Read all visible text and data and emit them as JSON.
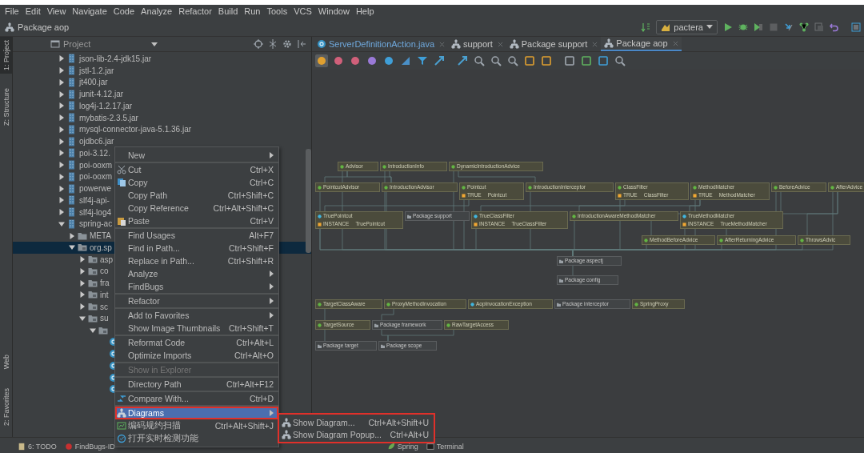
{
  "menu_bar": [
    "File",
    "Edit",
    "View",
    "Navigate",
    "Code",
    "Analyze",
    "Refactor",
    "Build",
    "Run",
    "Tools",
    "VCS",
    "Window",
    "Help"
  ],
  "navigation_bar": {
    "crumb": "Package aop",
    "run_config": "pactera"
  },
  "tool_strip": [
    {
      "label": "1: Project",
      "selected": true
    },
    {
      "label": "Z: Structure",
      "selected": false
    },
    {
      "label": "Web",
      "selected": false
    },
    {
      "label": "2: Favorites",
      "selected": false
    }
  ],
  "project_panel": {
    "title": "Project",
    "tree": [
      {
        "label": "json-lib-2.4-jdk15.jar",
        "kind": "jar",
        "expanded": false,
        "selected": false
      },
      {
        "label": "jstl-1.2.jar",
        "kind": "jar",
        "expanded": false,
        "selected": false
      },
      {
        "label": "jt400.jar",
        "kind": "jar",
        "expanded": false,
        "selected": false
      },
      {
        "label": "junit-4.12.jar",
        "kind": "jar",
        "expanded": false,
        "selected": false
      },
      {
        "label": "log4j-1.2.17.jar",
        "kind": "jar",
        "expanded": false,
        "selected": false
      },
      {
        "label": "mybatis-2.3.5.jar",
        "kind": "jar",
        "expanded": false,
        "selected": false
      },
      {
        "label": "mysql-connector-java-5.1.36.jar",
        "kind": "jar",
        "expanded": false,
        "selected": false
      },
      {
        "label": "ojdbc6.jar",
        "kind": "jar",
        "expanded": false,
        "selected": false
      },
      {
        "label": "poi-3.12.",
        "kind": "jar",
        "expanded": false,
        "selected": false
      },
      {
        "label": "poi-ooxm",
        "kind": "jar",
        "expanded": false,
        "selected": false
      },
      {
        "label": "poi-ooxm",
        "kind": "jar",
        "expanded": false,
        "selected": false
      },
      {
        "label": "powerwe",
        "kind": "jar",
        "expanded": false,
        "selected": false
      },
      {
        "label": "slf4j-api-",
        "kind": "jar",
        "expanded": false,
        "selected": false
      },
      {
        "label": "slf4j-log4",
        "kind": "jar",
        "expanded": false,
        "selected": false
      },
      {
        "label": "spring-ac",
        "kind": "jar",
        "expanded": true,
        "selected": false,
        "children": [
          {
            "label": "META",
            "kind": "folder",
            "expanded": false,
            "selected": false
          },
          {
            "label": "org.sp",
            "kind": "package",
            "expanded": true,
            "selected": true,
            "children": [
              {
                "label": "asp",
                "kind": "package",
                "expanded": false,
                "selected": false
              },
              {
                "label": "co",
                "kind": "package",
                "expanded": false,
                "selected": false
              },
              {
                "label": "fra",
                "kind": "package",
                "expanded": false,
                "selected": false
              },
              {
                "label": "int",
                "kind": "package",
                "expanded": false,
                "selected": false
              },
              {
                "label": "sc",
                "kind": "package",
                "expanded": false,
                "selected": false
              },
              {
                "label": "su",
                "kind": "package",
                "expanded": true,
                "selected": false,
                "children": [
                  {
                    "kind": "package",
                    "expanded": true,
                    "selected": false,
                    "children": [
                      {
                        "kind": "class",
                        "selected": false
                      },
                      {
                        "kind": "class",
                        "selected": false
                      },
                      {
                        "kind": "class",
                        "selected": false
                      },
                      {
                        "kind": "class",
                        "selected": false
                      },
                      {
                        "kind": "class",
                        "selected": false
                      }
                    ]
                  }
                ]
              }
            ]
          }
        ]
      }
    ]
  },
  "editor_tabs": [
    {
      "label": "ServerDefinitionAction.java",
      "kind": "class",
      "selected": false
    },
    {
      "label": "support",
      "kind": "diagram",
      "selected": false
    },
    {
      "label": "Package support",
      "kind": "diagram",
      "selected": false
    },
    {
      "label": "Package aop",
      "kind": "diagram",
      "selected": true
    }
  ],
  "diagram": {
    "nodes": [
      {
        "label": "Advisor",
        "kind": "interface"
      },
      {
        "label": "IntroductionInfo",
        "kind": "interface"
      },
      {
        "label": "DynamicIntroductionAdvice",
        "kind": "interface"
      },
      {
        "label": "PointcutAdvisor",
        "kind": "interface"
      },
      {
        "label": "IntroductionAdvisor",
        "kind": "interface"
      },
      {
        "label": "Pointcut",
        "kind": "interface",
        "fields": [
          {
            "name": "TRUE",
            "type": "Pointcut"
          }
        ]
      },
      {
        "label": "IntroductionInterceptor",
        "kind": "interface"
      },
      {
        "label": "ClassFilter",
        "kind": "interface",
        "fields": [
          {
            "name": "TRUE",
            "type": "ClassFilter"
          }
        ]
      },
      {
        "label": "MethodMatcher",
        "kind": "interface",
        "fields": [
          {
            "name": "TRUE",
            "type": "MethodMatcher"
          }
        ]
      },
      {
        "label": "BeforeAdvice",
        "kind": "interface"
      },
      {
        "label": "AfterAdvice",
        "kind": "interface"
      },
      {
        "label": "TruePointcut",
        "kind": "class",
        "fields": [
          {
            "name": "INSTANCE",
            "type": "TruePointcut"
          }
        ]
      },
      {
        "label": "Package support",
        "kind": "package"
      },
      {
        "label": "TrueClassFilter",
        "kind": "class",
        "fields": [
          {
            "name": "INSTANCE",
            "type": "TrueClassFilter"
          }
        ]
      },
      {
        "label": "IntroductionAwareMethodMatcher",
        "kind": "interface"
      },
      {
        "label": "TrueMethodMatcher",
        "kind": "class",
        "fields": [
          {
            "name": "INSTANCE",
            "type": "TrueMethodMatcher"
          }
        ]
      },
      {
        "label": "MethodBeforeAdvice",
        "kind": "interface"
      },
      {
        "label": "AfterReturningAdvice",
        "kind": "interface"
      },
      {
        "label": "ThrowsAdvic",
        "kind": "interface"
      },
      {
        "label": "Package aspectj",
        "kind": "package"
      },
      {
        "label": "Package config",
        "kind": "package"
      },
      {
        "label": "TargetClassAware",
        "kind": "interface"
      },
      {
        "label": "ProxyMethodInvocation",
        "kind": "interface"
      },
      {
        "label": "AopInvocationException",
        "kind": "class"
      },
      {
        "label": "Package interceptor",
        "kind": "package"
      },
      {
        "label": "SpringProxy",
        "kind": "interface"
      },
      {
        "label": "TargetSource",
        "kind": "interface"
      },
      {
        "label": "Package framework",
        "kind": "package"
      },
      {
        "label": "RawTargetAccess",
        "kind": "interface"
      },
      {
        "label": "Package target",
        "kind": "package"
      },
      {
        "label": "Package scope",
        "kind": "package"
      }
    ]
  },
  "context_menu": {
    "items": [
      {
        "label": "New",
        "submenu": true,
        "separator_before": false,
        "disabled": false,
        "selected": false,
        "highlighted": false
      },
      {
        "label": "Cut",
        "shortcut": "Ctrl+X",
        "submenu": false,
        "separator_before": true,
        "disabled": false,
        "selected": false,
        "highlighted": false
      },
      {
        "label": "Copy",
        "shortcut": "Ctrl+C",
        "submenu": false,
        "separator_before": false,
        "disabled": false,
        "selected": false,
        "highlighted": false
      },
      {
        "label": "Copy Path",
        "shortcut": "Ctrl+Shift+C",
        "submenu": false,
        "separator_before": false,
        "disabled": false,
        "selected": false,
        "highlighted": false
      },
      {
        "label": "Copy Reference",
        "shortcut": "Ctrl+Alt+Shift+C",
        "submenu": false,
        "separator_before": false,
        "disabled": false,
        "selected": false,
        "highlighted": false
      },
      {
        "label": "Paste",
        "shortcut": "Ctrl+V",
        "submenu": false,
        "separator_before": false,
        "disabled": false,
        "selected": false,
        "highlighted": false
      },
      {
        "label": "Find Usages",
        "shortcut": "Alt+F7",
        "submenu": false,
        "separator_before": true,
        "disabled": false,
        "selected": false,
        "highlighted": false
      },
      {
        "label": "Find in Path...",
        "shortcut": "Ctrl+Shift+F",
        "submenu": false,
        "separator_before": false,
        "disabled": false,
        "selected": false,
        "highlighted": false
      },
      {
        "label": "Replace in Path...",
        "shortcut": "Ctrl+Shift+R",
        "submenu": false,
        "separator_before": false,
        "disabled": false,
        "selected": false,
        "highlighted": false
      },
      {
        "label": "Analyze",
        "submenu": true,
        "separator_before": false,
        "disabled": false,
        "selected": false,
        "highlighted": false
      },
      {
        "label": "FindBugs",
        "submenu": true,
        "separator_before": false,
        "disabled": false,
        "selected": false,
        "highlighted": false
      },
      {
        "label": "Refactor",
        "submenu": true,
        "separator_before": true,
        "disabled": false,
        "selected": false,
        "highlighted": false
      },
      {
        "label": "Add to Favorites",
        "submenu": true,
        "separator_before": true,
        "disabled": false,
        "selected": false,
        "highlighted": false
      },
      {
        "label": "Show Image Thumbnails",
        "shortcut": "Ctrl+Shift+T",
        "submenu": false,
        "separator_before": false,
        "disabled": false,
        "selected": false,
        "highlighted": false
      },
      {
        "label": "Reformat Code",
        "shortcut": "Ctrl+Alt+L",
        "submenu": false,
        "separator_before": true,
        "disabled": false,
        "selected": false,
        "highlighted": false
      },
      {
        "label": "Optimize Imports",
        "shortcut": "Ctrl+Alt+O",
        "submenu": false,
        "separator_before": false,
        "disabled": false,
        "selected": false,
        "highlighted": false
      },
      {
        "label": "Show in Explorer",
        "submenu": false,
        "separator_before": true,
        "disabled": true,
        "selected": false,
        "highlighted": false
      },
      {
        "label": "Directory Path",
        "shortcut": "Ctrl+Alt+F12",
        "submenu": false,
        "separator_before": true,
        "disabled": false,
        "selected": false,
        "highlighted": false
      },
      {
        "label": "Compare With...",
        "shortcut": "Ctrl+D",
        "submenu": false,
        "separator_before": true,
        "disabled": false,
        "selected": false,
        "highlighted": false
      },
      {
        "label": "Diagrams",
        "submenu": true,
        "separator_before": true,
        "disabled": false,
        "selected": true,
        "highlighted": true
      },
      {
        "label": "编码规约扫描",
        "shortcut": "Ctrl+Alt+Shift+J",
        "submenu": false,
        "separator_before": false,
        "disabled": false,
        "selected": false,
        "highlighted": false
      },
      {
        "label": "打开实时检测功能",
        "submenu": false,
        "separator_before": false,
        "disabled": false,
        "selected": false,
        "highlighted": false
      }
    ]
  },
  "submenu": {
    "highlighted": true,
    "items": [
      {
        "label": "Show Diagram...",
        "shortcut": "Ctrl+Alt+Shift+U"
      },
      {
        "label": "Show Diagram Popup...",
        "shortcut": "Ctrl+Alt+U"
      }
    ]
  },
  "bottom_bar": [
    {
      "label": "6: TODO"
    },
    {
      "label": "FindBugs-ID"
    },
    {
      "label": "Spring"
    },
    {
      "label": "Terminal"
    }
  ]
}
